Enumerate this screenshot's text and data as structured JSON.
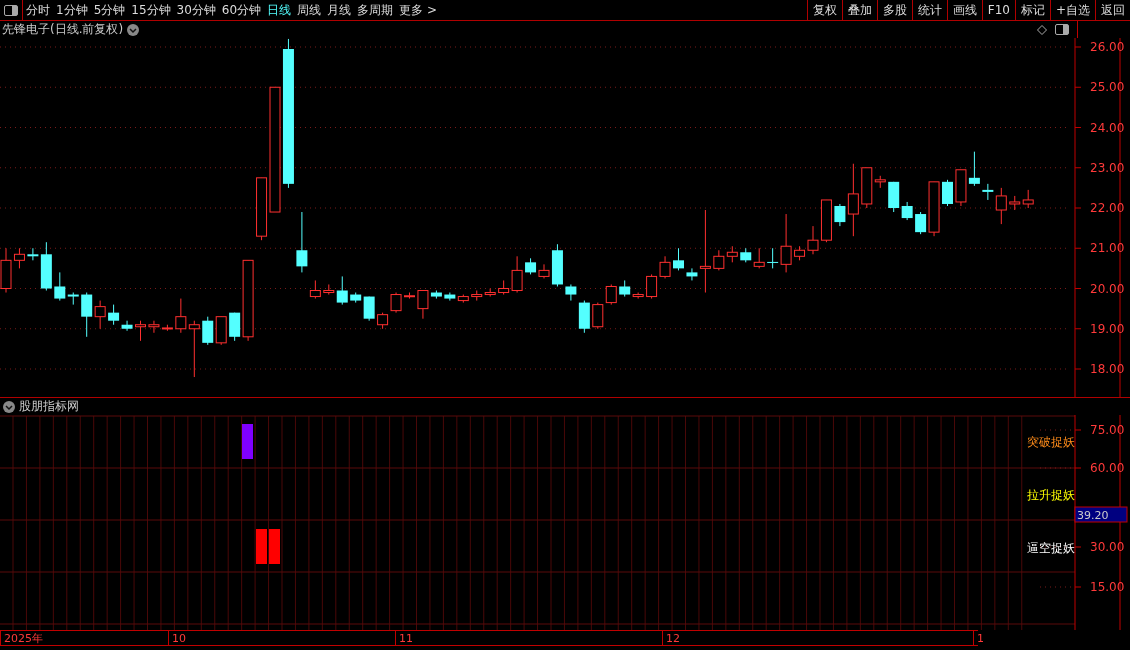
{
  "toolbar": {
    "periods": [
      {
        "label": "分时",
        "selected": false
      },
      {
        "label": "1分钟",
        "selected": false
      },
      {
        "label": "5分钟",
        "selected": false
      },
      {
        "label": "15分钟",
        "selected": false
      },
      {
        "label": "30分钟",
        "selected": false
      },
      {
        "label": "60分钟",
        "selected": false
      },
      {
        "label": "日线",
        "selected": true
      },
      {
        "label": "周线",
        "selected": false
      },
      {
        "label": "月线",
        "selected": false
      },
      {
        "label": "多周期",
        "selected": false
      },
      {
        "label": "更多 >",
        "selected": false
      }
    ],
    "buttons": [
      "复权",
      "叠加",
      "多股",
      "统计",
      "画线",
      "F10",
      "标记",
      "+自选",
      "返回"
    ]
  },
  "price_chart": {
    "title": "先锋电子(日线.前复权)",
    "axis_labels": [
      "26.00",
      "25.00",
      "24.00",
      "23.00",
      "22.00",
      "21.00",
      "20.00",
      "19.00",
      "18.00"
    ]
  },
  "indicator": {
    "title": "股朋指标网",
    "axis_labels": [
      "75.00",
      "60.00",
      "30.00",
      "15.00"
    ],
    "current_value": "39.20",
    "legend": [
      {
        "label": "突破捉妖",
        "color": "#ff8c1a"
      },
      {
        "label": "拉升捉妖",
        "color": "#ffff00"
      },
      {
        "label": "逼空捉妖",
        "color": "#ffffff"
      }
    ]
  },
  "time_axis": {
    "labels": [
      "2025年",
      "10",
      "11",
      "12",
      "1"
    ]
  }
}
